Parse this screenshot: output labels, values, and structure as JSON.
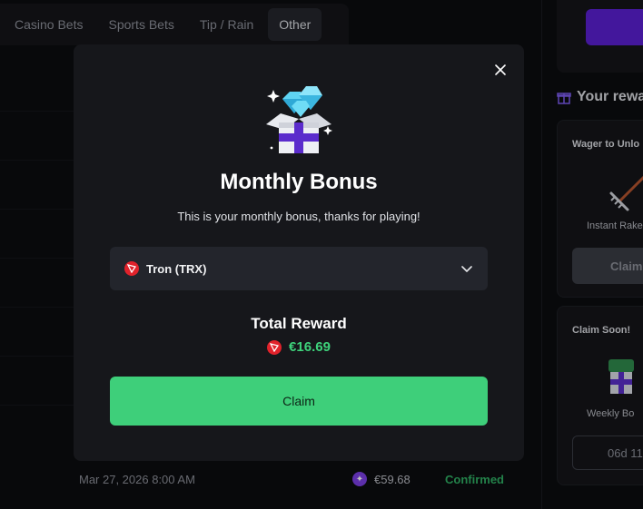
{
  "tabs": [
    {
      "label": "Casino Bets"
    },
    {
      "label": "Sports Bets"
    },
    {
      "label": "Tip / Rain"
    },
    {
      "label": "Other",
      "active": true
    }
  ],
  "table": {
    "visible_row": {
      "date": "Mar 27, 2026 8:00 AM",
      "amount": "€59.68",
      "status": "Confirmed"
    }
  },
  "sidebar": {
    "title": "Your rewa",
    "card1": {
      "title": "Wager to Unlo",
      "item_label": "Instant Rake",
      "button_label": "Claim"
    },
    "card2": {
      "title": "Claim Soon!",
      "item_label": "Weekly Bo",
      "countdown": "06d 11"
    }
  },
  "modal": {
    "title": "Monthly Bonus",
    "subtitle": "This is your monthly bonus, thanks for playing!",
    "currency_select": {
      "selected": "Tron (TRX)",
      "icon": "tron-icon"
    },
    "reward_title": "Total Reward",
    "reward_amount": "€16.69",
    "claim_label": "Claim"
  },
  "colors": {
    "accent_green": "#3ecf7a",
    "brand_purple": "#5a1fd0",
    "tron_red": "#e1222b",
    "modal_bg": "#16171b"
  }
}
